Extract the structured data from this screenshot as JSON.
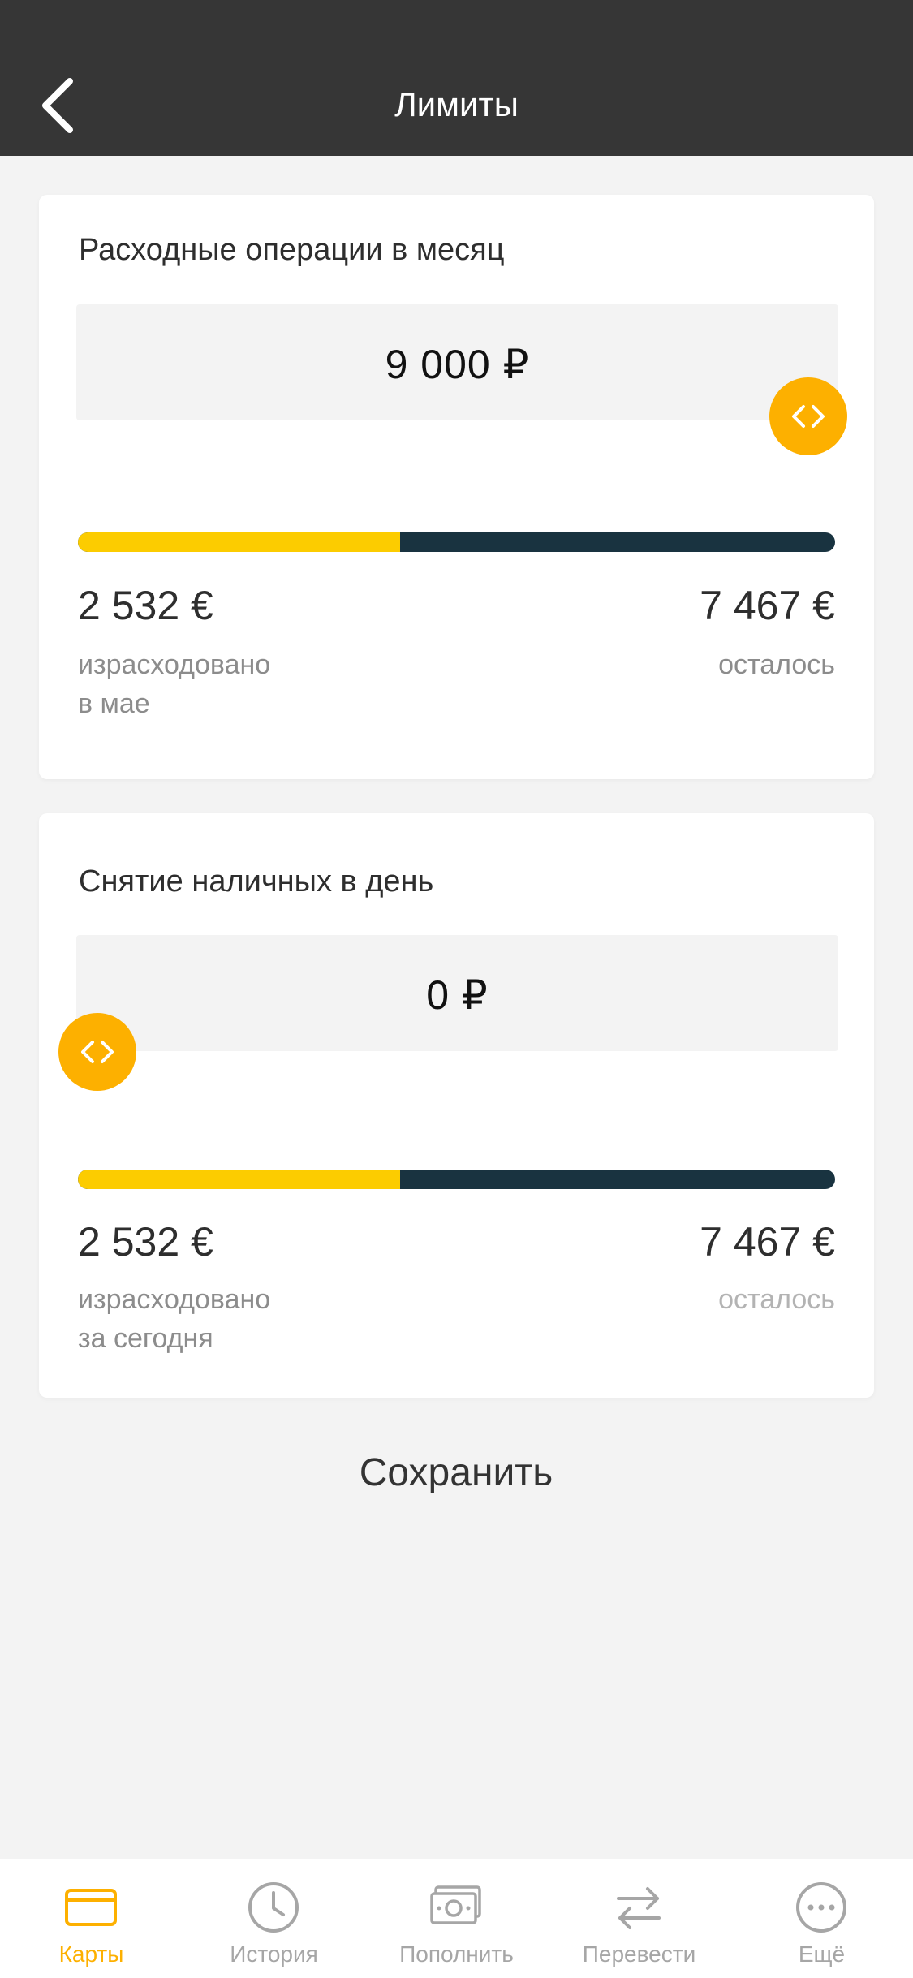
{
  "header": {
    "title": "Лимиты",
    "back_icon": "chevron-left-icon"
  },
  "colors": {
    "accent": "#fdb000",
    "progress_spent": "#fccc00",
    "progress_remaining": "#193340",
    "header_bg": "#363636"
  },
  "limits": [
    {
      "title": "Расходные операции в месяц",
      "amount": "9 000 ₽",
      "slider_icon": "slider-arrows-icon",
      "spent_fraction": 0.425,
      "spent_value": "2 532 €",
      "spent_label_line1": "израсходовано",
      "spent_label_line2": "в мае",
      "remaining_value": "7 467 €",
      "remaining_label": "осталось"
    },
    {
      "title": "Снятие наличных в день",
      "amount": "0 ₽",
      "slider_icon": "slider-arrows-icon",
      "spent_fraction": 0.425,
      "spent_value": "2 532 €",
      "spent_label_line1": "израсходовано",
      "spent_label_line2": "за сегодня",
      "remaining_value": "7 467 €",
      "remaining_label": "осталось"
    }
  ],
  "save_label": "Сохранить",
  "tabbar": {
    "items": [
      {
        "label": "Карты",
        "icon": "card-icon",
        "active": true
      },
      {
        "label": "История",
        "icon": "clock-icon",
        "active": false
      },
      {
        "label": "Пополнить",
        "icon": "banknote-icon",
        "active": false
      },
      {
        "label": "Перевести",
        "icon": "transfer-icon",
        "active": false
      },
      {
        "label": "Ещё",
        "icon": "more-icon",
        "active": false
      }
    ]
  }
}
